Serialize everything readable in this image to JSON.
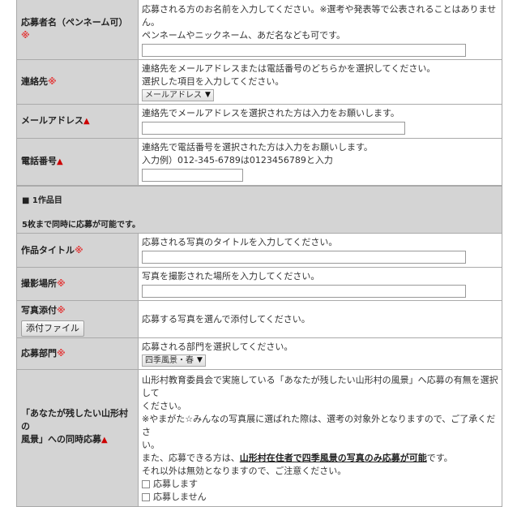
{
  "contact_section": {
    "pen_name": {
      "label": "応募者名（ペンネーム可）",
      "req": "※",
      "help_line1": "応募される方のお名前を入力してください。※選考や発表等で公表されることはありません。",
      "help_line2": "ペンネームやニックネーム、あだ名なども可です。",
      "value": ""
    },
    "contact": {
      "label": "連絡先",
      "req": "※",
      "help_line1": "連絡先をメールアドレスまたは電話番号のどちらかを選択してください。",
      "help_line2": "選択した項目を入力してください。",
      "select_value": "メールアドレス"
    },
    "email": {
      "label": "メールアドレス",
      "mark": "▲",
      "help": "連絡先でメールアドレスを選択された方は入力をお願いします。",
      "value": ""
    },
    "phone": {
      "label": "電話番号",
      "mark": "▲",
      "help_line1": "連絡先で電話番号を選択された方は入力をお願いします。",
      "help_line2": "入力例）012-345-6789は0123456789と入力",
      "value": ""
    }
  },
  "work1": {
    "title": "■ 1作品目",
    "note": "5枚まで同時に応募が可能です。",
    "work_title": {
      "label": "作品タイトル",
      "req": "※",
      "help": "応募される写真のタイトルを入力してください。",
      "value": ""
    },
    "location": {
      "label": "撮影場所",
      "req": "※",
      "help": "写真を撮影された場所を入力してください。",
      "value": ""
    },
    "attach": {
      "label": "写真添付",
      "req": "※",
      "button": "添付ファイル",
      "help": "応募する写真を選んで添付してください。"
    },
    "category": {
      "label": "応募部門",
      "req": "※",
      "help": "応募される部門を選択してください。",
      "select_value": "四季風景・春"
    },
    "simultaneous": {
      "label_line1": "「あなたが残したい山形村の",
      "label_line2": "風景」への同時応募",
      "mark": "▲",
      "text_line1": "山形村教育委員会で実施している「あなたが残したい山形村の風景」へ応募の有無を選択して",
      "text_line2": "ください。",
      "text_line3": "※やまがた☆みんなの写真展に選ばれた際は、選考の対象外となりますので、ご了承くださ",
      "text_line4": "い。",
      "text_line5_pre": "また、応募できる方は、",
      "text_line5_emph": "山形村在住者で四季風景の写真のみ応募が可能",
      "text_line5_post": "です。",
      "text_line6": "それ以外は無効となりますので、ご注意ください。",
      "option_yes": "応募します",
      "option_no": "応募しません"
    }
  }
}
